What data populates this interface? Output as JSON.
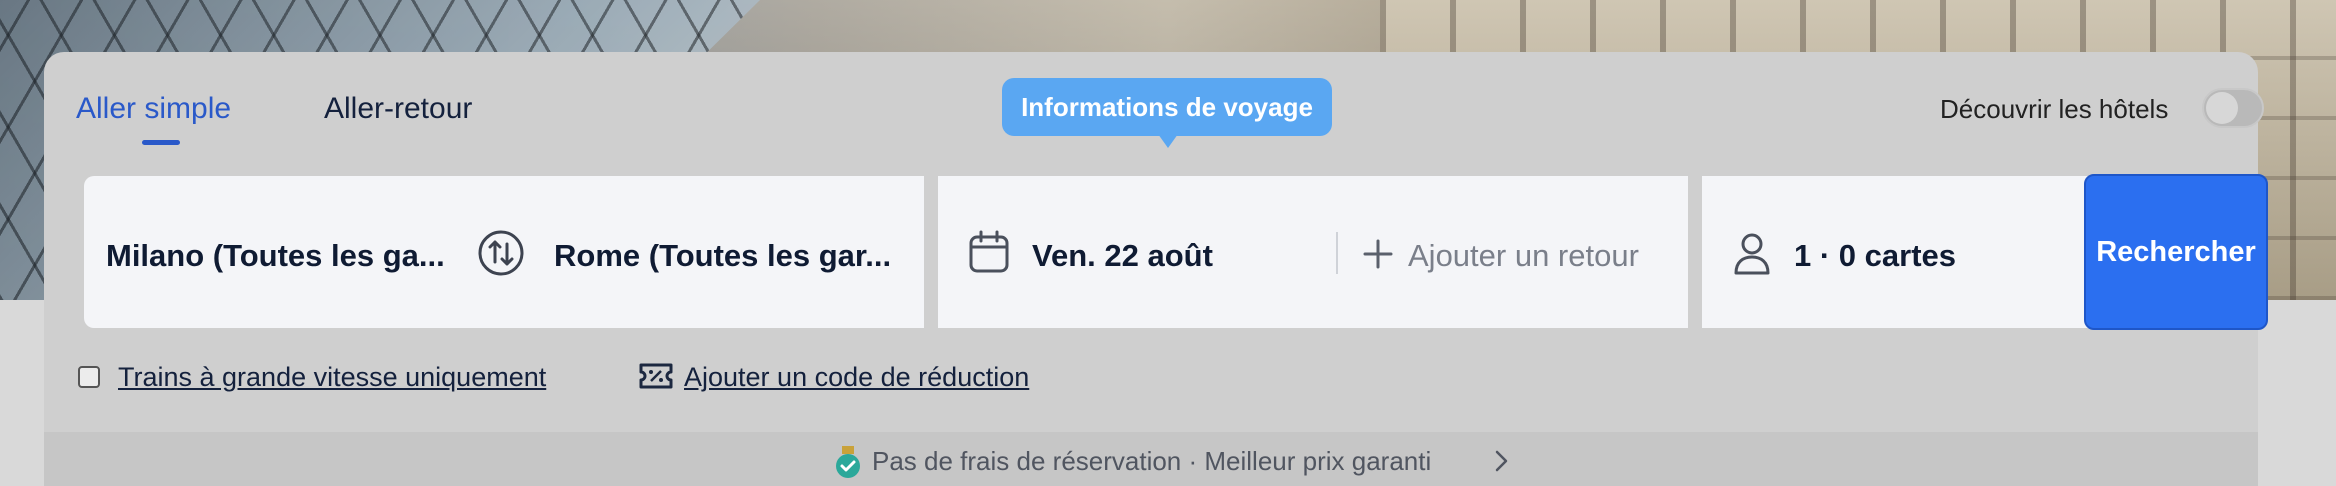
{
  "trip_type_tabs": [
    {
      "label": "Aller simple",
      "active": true
    },
    {
      "label": "Aller-retour",
      "active": false
    }
  ],
  "tooltip": {
    "text": "Informations de voyage"
  },
  "hotels_toggle": {
    "label": "Découvrir les hôtels",
    "enabled": false
  },
  "search": {
    "origin": "Milano (Toutes les ga...",
    "destination": "Rome (Toutes les gar...",
    "departure_date": "Ven. 22 août",
    "return_placeholder": "Ajouter un retour",
    "passengers": "1 · 0 cartes",
    "search_button": "Rechercher"
  },
  "options": {
    "high_speed_only": {
      "label": "Trains à grande vitesse uniquement",
      "checked": false
    },
    "discount_code": {
      "label": "Ajouter un code de réduction"
    }
  },
  "footer": {
    "text": "Pas de frais de réservation · Meilleur prix garanti"
  },
  "colors": {
    "accent": "#2a59c9",
    "button": "#2b6ff0",
    "tooltip": "#5aa7f2"
  },
  "icons": {
    "swap": "swap-icon",
    "calendar": "calendar-icon",
    "plus": "plus-icon",
    "person": "person-icon",
    "ticket": "ticket-discount-icon",
    "badge": "verified-badge-icon",
    "chevron": "chevron-right-icon"
  }
}
